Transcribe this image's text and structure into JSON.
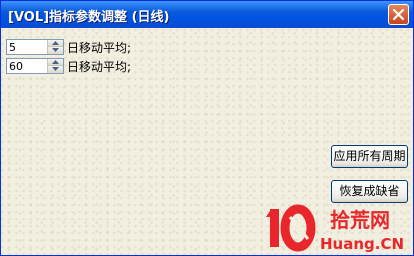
{
  "window": {
    "title": "[VOL]指标参数调整 (日线)",
    "close_icon": "close-icon"
  },
  "params": [
    {
      "value": "5",
      "label": "日移动平均;"
    },
    {
      "value": "60",
      "label": "日移动平均;"
    }
  ],
  "buttons": {
    "apply_all_periods": "应用所有周期",
    "restore_defaults": "恢复成缺省"
  },
  "watermark": {
    "logo_mark": "10",
    "site_name": "拾荒网",
    "domain": "Huang.CN"
  },
  "colors": {
    "titlebar": "#0054e3",
    "dialog_bg": "#f2efe0",
    "watermark_red": "#e8262b"
  }
}
